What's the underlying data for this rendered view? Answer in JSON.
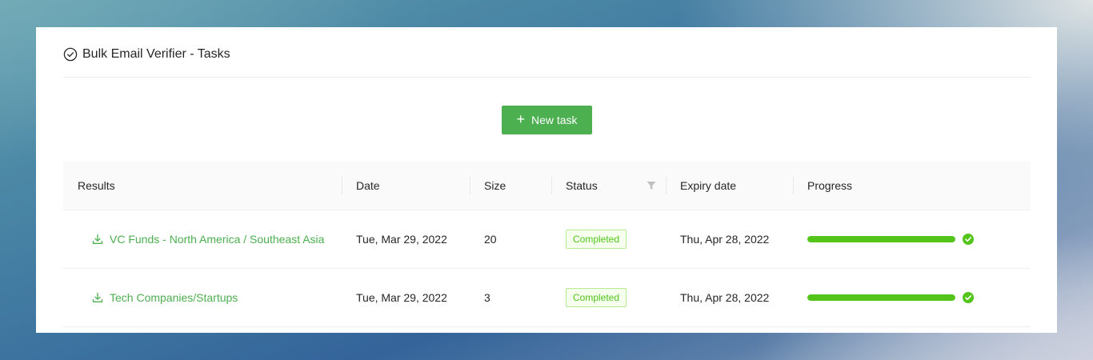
{
  "page": {
    "title": "Bulk Email Verifier - Tasks",
    "title_icon": "check-circle-icon"
  },
  "toolbar": {
    "new_task_label": "New task",
    "new_task_icon": "plus-icon"
  },
  "table": {
    "columns": [
      "Results",
      "Date",
      "Size",
      "Status",
      "Expiry date",
      "Progress"
    ],
    "rows": [
      {
        "result": "VC Funds - North America / Southeast Asia",
        "date": "Tue, Mar 29, 2022",
        "size": "20",
        "status": "Completed",
        "expiry": "Thu, Apr 28, 2022",
        "progress": 100
      },
      {
        "result": "Tech Companies/Startups",
        "date": "Tue, Mar 29, 2022",
        "size": "3",
        "status": "Completed",
        "expiry": "Thu, Apr 28, 2022",
        "progress": 100
      }
    ]
  },
  "colors": {
    "accent": "#4caf50",
    "progress": "#52c41a",
    "status_text": "#52c41a",
    "status_bg": "#f6ffed",
    "status_border": "#b7eb8f"
  }
}
